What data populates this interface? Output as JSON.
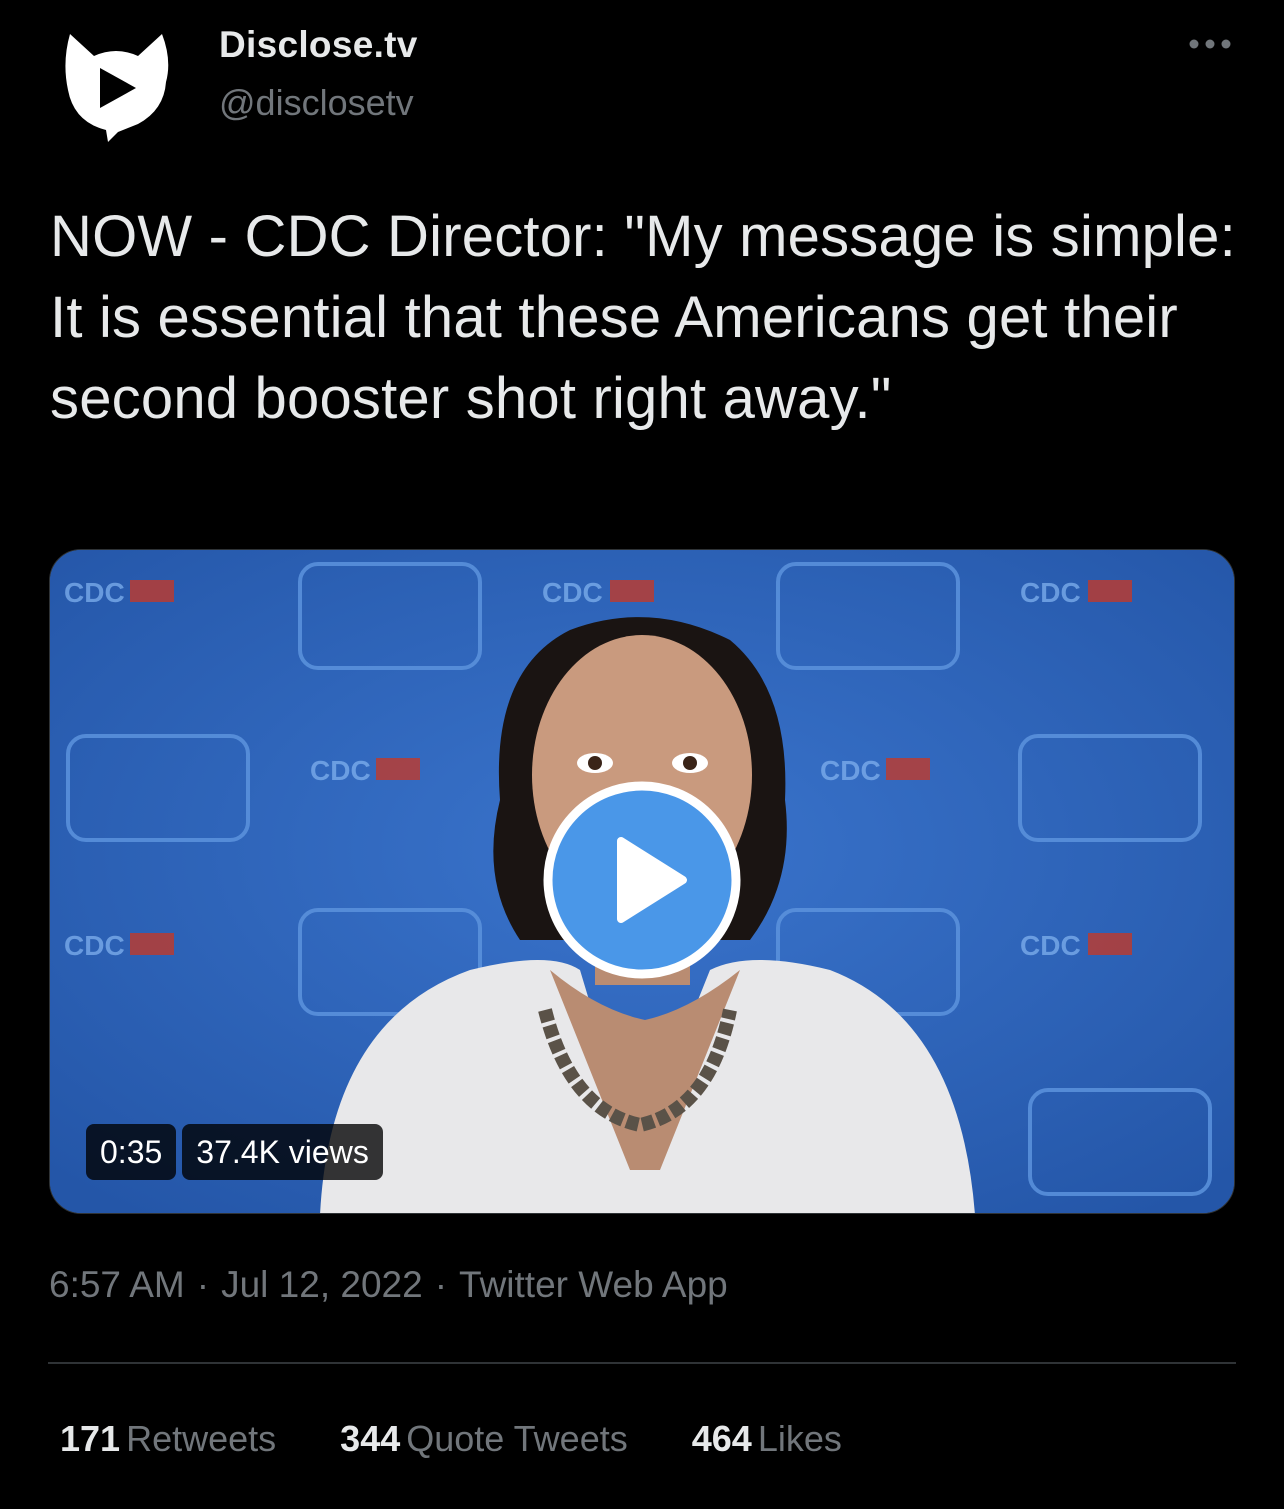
{
  "user": {
    "display_name": "Disclose.tv",
    "handle": "@disclosetv",
    "avatar_icon": "disclose-tv-logo-icon"
  },
  "more_icon": "more-options-icon",
  "tweet": {
    "text": "NOW - CDC Director: \"My message is simple: It is essential that these Americans get their second booster shot right away.\""
  },
  "video": {
    "duration": "0:35",
    "views": "37.4K views",
    "play_icon": "play-icon",
    "backdrop_logo": "CDC"
  },
  "meta": {
    "time": "6:57 AM",
    "separator": "·",
    "date": "Jul 12, 2022",
    "source": "Twitter Web App"
  },
  "stats": {
    "retweets_count": "171",
    "retweets_label": "Retweets",
    "quotes_count": "344",
    "quotes_label": "Quote Tweets",
    "likes_count": "464",
    "likes_label": "Likes"
  },
  "colors": {
    "background": "#000000",
    "text_primary": "#e7e9ea",
    "text_secondary": "#71767b",
    "accent_play": "#4a97e8",
    "video_backdrop": "#2e63b8"
  }
}
